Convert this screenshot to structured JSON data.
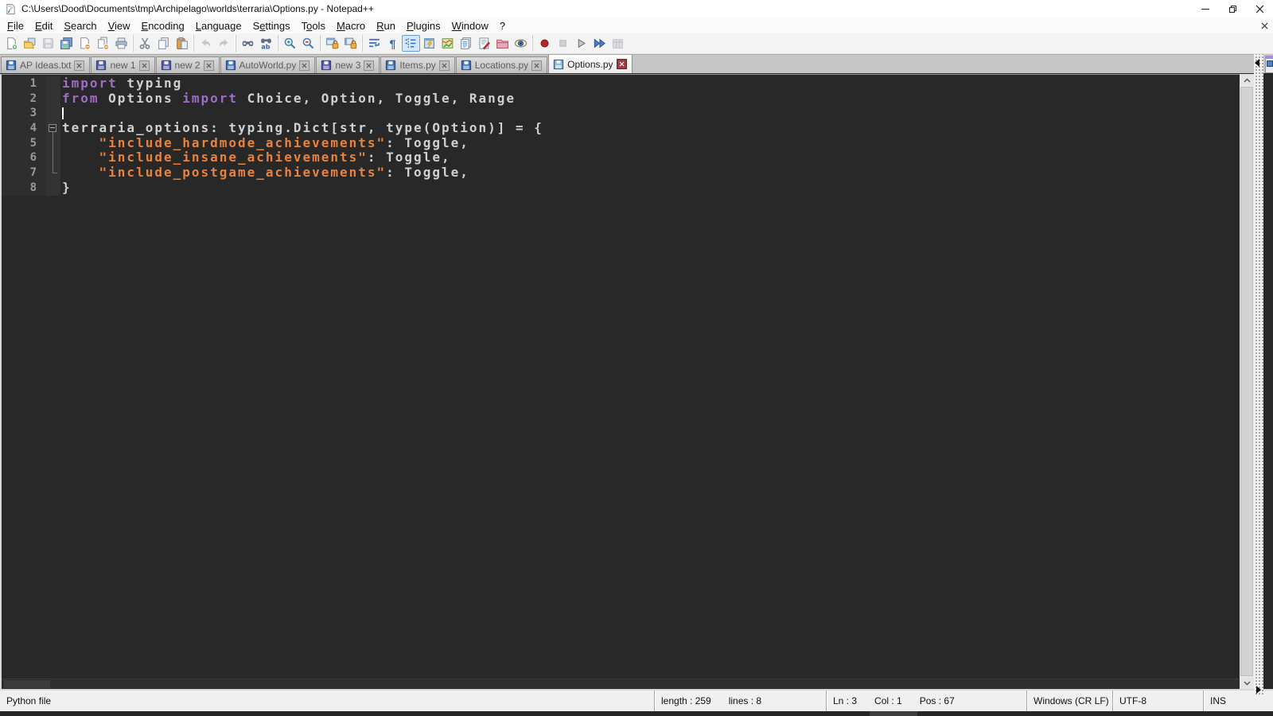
{
  "window": {
    "title": "C:\\Users\\Dood\\Documents\\tmp\\Archipelago\\worlds\\terraria\\Options.py - Notepad++"
  },
  "colors": {
    "keyword": "#a06cc8",
    "string": "#e8823d",
    "plain": "#d0d0d0",
    "editor_bg": "#282828",
    "margin_bg": "#2e2e2e",
    "pressed_button_bg": "#d5e8f9"
  },
  "menu": {
    "items": [
      {
        "label": "File",
        "u": 0
      },
      {
        "label": "Edit",
        "u": 0
      },
      {
        "label": "Search",
        "u": 0
      },
      {
        "label": "View",
        "u": 0
      },
      {
        "label": "Encoding",
        "u": 0
      },
      {
        "label": "Language",
        "u": 0
      },
      {
        "label": "Settings",
        "u": 1
      },
      {
        "label": "Tools",
        "u": 1
      },
      {
        "label": "Macro",
        "u": 0
      },
      {
        "label": "Run",
        "u": 0
      },
      {
        "label": "Plugins",
        "u": 0
      },
      {
        "label": "Window",
        "u": 0
      },
      {
        "label": "?",
        "u": -1
      }
    ]
  },
  "toolbar": {
    "groups": [
      [
        {
          "icon": "new-file-icon",
          "label": "New"
        },
        {
          "icon": "open-file-icon",
          "label": "Open"
        },
        {
          "icon": "save-icon",
          "label": "Save",
          "disabled": true
        },
        {
          "icon": "save-all-icon",
          "label": "Save All"
        },
        {
          "icon": "close-icon",
          "label": "Close"
        },
        {
          "icon": "close-all-icon",
          "label": "Close All"
        },
        {
          "icon": "print-icon",
          "label": "Print"
        }
      ],
      [
        {
          "icon": "cut-icon",
          "label": "Cut"
        },
        {
          "icon": "copy-icon",
          "label": "Copy"
        },
        {
          "icon": "paste-icon",
          "label": "Paste"
        }
      ],
      [
        {
          "icon": "undo-icon",
          "label": "Undo",
          "disabled": true
        },
        {
          "icon": "redo-icon",
          "label": "Redo",
          "disabled": true
        }
      ],
      [
        {
          "icon": "find-icon",
          "label": "Find"
        },
        {
          "icon": "replace-icon",
          "label": "Replace"
        }
      ],
      [
        {
          "icon": "zoom-in-icon",
          "label": "Zoom In"
        },
        {
          "icon": "zoom-out-icon",
          "label": "Zoom Out"
        }
      ],
      [
        {
          "icon": "sync-vertical-icon",
          "label": "Synchronize Vertical Scrolling"
        },
        {
          "icon": "sync-horizontal-icon",
          "label": "Synchronize Horizontal Scrolling"
        }
      ],
      [
        {
          "icon": "word-wrap-icon",
          "label": "Word Wrap"
        },
        {
          "icon": "show-all-characters-icon",
          "label": "Show All Characters"
        },
        {
          "icon": "show-indent-guide-icon",
          "label": "Show Indent Guide",
          "pressed": true
        },
        {
          "icon": "define-language-icon",
          "label": "Define your Language"
        },
        {
          "icon": "document-map-icon",
          "label": "Document Map"
        },
        {
          "icon": "document-list-icon",
          "label": "Document List"
        },
        {
          "icon": "function-list-icon",
          "label": "Function List"
        },
        {
          "icon": "folder-as-workspace-icon",
          "label": "Folder as Workspace"
        },
        {
          "icon": "monitoring-icon",
          "label": "Monitoring (tail -f)"
        }
      ],
      [
        {
          "icon": "macro-record-icon",
          "label": "Start Recording"
        },
        {
          "icon": "macro-stop-icon",
          "label": "Stop Recording",
          "disabled": true
        },
        {
          "icon": "macro-play-icon",
          "label": "Playback"
        },
        {
          "icon": "macro-run-multiple-icon",
          "label": "Run a Macro Multiple Times"
        },
        {
          "icon": "macro-save-icon",
          "label": "Save Current Recorded Macro",
          "disabled": true
        }
      ]
    ]
  },
  "tabs": [
    {
      "label": "AP Ideas.txt",
      "state": "saved",
      "active": false
    },
    {
      "label": "new 1",
      "state": "new",
      "active": false
    },
    {
      "label": "new 2",
      "state": "new",
      "active": false
    },
    {
      "label": "AutoWorld.py",
      "state": "saved",
      "active": false
    },
    {
      "label": "new 3",
      "state": "new",
      "active": false
    },
    {
      "label": "Items.py",
      "state": "saved",
      "active": false
    },
    {
      "label": "Locations.py",
      "state": "saved",
      "active": false
    },
    {
      "label": "Options.py",
      "state": "saved",
      "active": true
    }
  ],
  "editor": {
    "lines": [
      {
        "n": "1",
        "fold": "",
        "caret": false,
        "tokens": [
          [
            "k",
            "import"
          ],
          [
            "p",
            " typing"
          ]
        ]
      },
      {
        "n": "2",
        "fold": "",
        "caret": false,
        "tokens": [
          [
            "k",
            "from"
          ],
          [
            "p",
            " Options "
          ],
          [
            "k",
            "import"
          ],
          [
            "p",
            " Choice, Option, Toggle, Range"
          ]
        ]
      },
      {
        "n": "3",
        "fold": "",
        "caret": true,
        "tokens": []
      },
      {
        "n": "4",
        "fold": "box",
        "caret": false,
        "tokens": [
          [
            "p",
            "terraria_options: typing.Dict[str, type(Option)] = {"
          ]
        ]
      },
      {
        "n": "5",
        "fold": "line",
        "caret": false,
        "tokens": [
          [
            "p",
            "    "
          ],
          [
            "s",
            "\"include_hardmode_achievements\""
          ],
          [
            "p",
            ": Toggle,"
          ]
        ]
      },
      {
        "n": "6",
        "fold": "line",
        "caret": false,
        "tokens": [
          [
            "p",
            "    "
          ],
          [
            "s",
            "\"include_insane_achievements\""
          ],
          [
            "p",
            ": Toggle,"
          ]
        ]
      },
      {
        "n": "7",
        "fold": "corner",
        "caret": false,
        "tokens": [
          [
            "p",
            "    "
          ],
          [
            "s",
            "\"include_postgame_achievements\""
          ],
          [
            "p",
            ": Toggle,"
          ]
        ]
      },
      {
        "n": "8",
        "fold": "",
        "caret": false,
        "tokens": [
          [
            "p",
            "}"
          ]
        ]
      }
    ]
  },
  "status_bar": {
    "doc_type": "Python file",
    "length": "length : 259",
    "lines": "lines : 8",
    "ln": "Ln : 3",
    "col": "Col : 1",
    "pos": "Pos : 67",
    "eol": "Windows (CR LF)",
    "encoding": "UTF-8",
    "insert_mode": "INS"
  }
}
